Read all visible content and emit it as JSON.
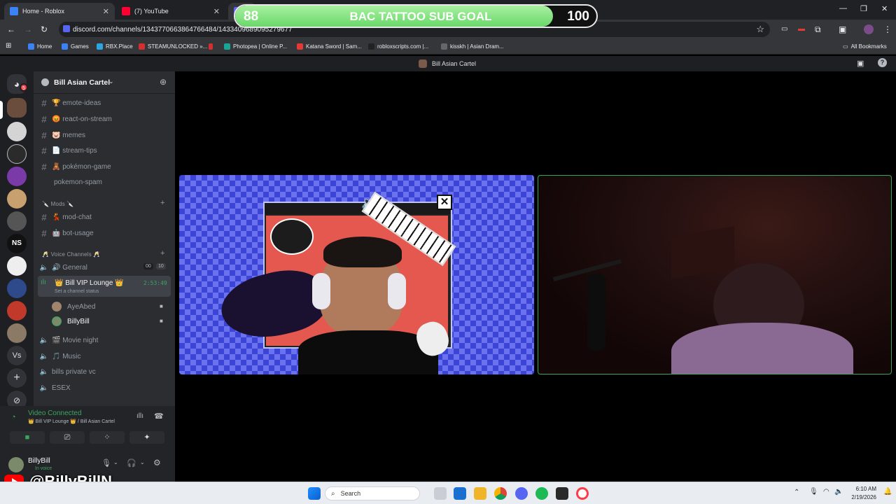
{
  "browser": {
    "tabs": [
      {
        "title": "Home - Roblox",
        "color": "#3b82f6"
      },
      {
        "title": "(7) YouTube",
        "color": "#ff0033"
      },
      {
        "title": "",
        "color": "#5865f2"
      }
    ],
    "url": "discord.com/channels/1343770663864766484/1433409689095279677",
    "bookmarks": [
      {
        "label": "Home",
        "color": "#3b82f6"
      },
      {
        "label": "Games",
        "color": "#3b82f6"
      },
      {
        "label": "RBX.Place",
        "color": "#2aa6e0"
      },
      {
        "label": "STEAMUNLOCKED »...",
        "color": "#d32f2f"
      },
      {
        "label": "",
        "color": "#d32f2f"
      },
      {
        "label": "Photopea | Online P...",
        "color": "#18a497"
      },
      {
        "label": "Katana Sword | Sam...",
        "color": "#e53935"
      },
      {
        "label": "robloxscripts.com |...",
        "color": "#222222"
      },
      {
        "label": "kisskh | Asian Dram...",
        "color": "#666666"
      }
    ],
    "all_bookmarks": "All Bookmarks"
  },
  "goal": {
    "start": "88",
    "title": "BAC TATTOO SUB GOAL",
    "end": "100",
    "progress": 0.88
  },
  "discord": {
    "server_title": "Bill Asian Cartel",
    "server_name": "Bill Asian Cartel",
    "badge": "5",
    "text_channels": [
      {
        "name": "🏆 emote-ideas",
        "hash": true
      },
      {
        "name": "😡 react-on-stream",
        "hash": true
      },
      {
        "name": "🐷 memes",
        "hash": true
      },
      {
        "name": "📄 stream-tips",
        "hash": true
      },
      {
        "name": "🧸 pokémon-game",
        "hash": true
      },
      {
        "name": "pokemon-spam",
        "hash": false
      }
    ],
    "mods_category": "🔪 Mods 🔪",
    "mods_channels": [
      {
        "name": "💃 mod-chat"
      },
      {
        "name": "🤖 bot-usage"
      }
    ],
    "voice_category": "🥂 Voice Channels 🥂",
    "voice_channels": {
      "general": {
        "name": "🔊 General",
        "count_a": "00",
        "count_b": "10"
      },
      "vip": {
        "name": "👑 Bill VIP Lounge 👑",
        "timer": "2:53:49",
        "status": "Set a channel status"
      },
      "members": [
        {
          "name": "AyeAbed"
        },
        {
          "name": "BillyBill"
        }
      ],
      "others": [
        {
          "name": "🎬 Movie night"
        },
        {
          "name": "🎵 Music"
        },
        {
          "name": "bills private vc"
        },
        {
          "name": "ESEX"
        }
      ]
    },
    "connection": {
      "status": "Video Connected",
      "location": "👑 Bill VIP Lounge 👑 / Bill Asian Cartel"
    },
    "user": {
      "name": "BillyBill",
      "sub": "In voice"
    },
    "watermark": "@BillyBillN"
  },
  "taskbar": {
    "search": "Search",
    "time": "6:10 AM",
    "date": "2/19/2026"
  }
}
